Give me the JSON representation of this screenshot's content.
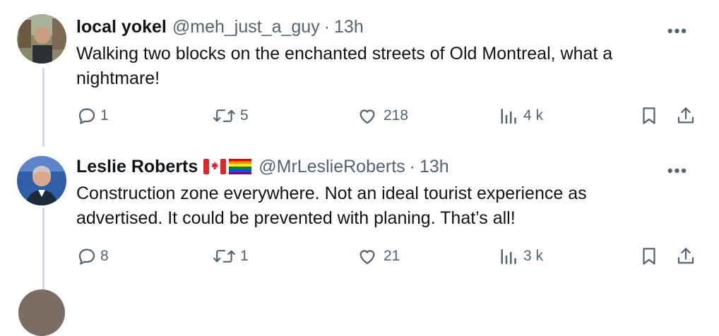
{
  "tweets": [
    {
      "name": "local yokel",
      "handle": "@meh_just_a_guy",
      "separator": "·",
      "time": "13h",
      "more": "•••",
      "text": "Walking two blocks on the enchanted streets of Old Montreal, what a nightmare!",
      "replies": "1",
      "retweets": "5",
      "likes": "218",
      "views": "4 k"
    },
    {
      "name": "Leslie Roberts",
      "handle": "@MrLeslieRoberts",
      "separator": "·",
      "time": "13h",
      "more": "•••",
      "text": "Construction zone everywhere. Not an ideal tourist  experience as advertised.  It could be prevented with planing. That’s all!",
      "replies": "8",
      "retweets": "1",
      "likes": "21",
      "views": "3 k"
    }
  ],
  "icons": {
    "reply": "reply-icon",
    "retweet": "retweet-icon",
    "like": "heart-icon",
    "views": "views-icon",
    "bookmark": "bookmark-icon",
    "share": "share-icon",
    "flags": [
      "canada-flag-icon",
      "rainbow-flag-icon"
    ]
  },
  "colors": {
    "text": "#0f1419",
    "secondary": "#536471",
    "line": "#cfd9de"
  }
}
